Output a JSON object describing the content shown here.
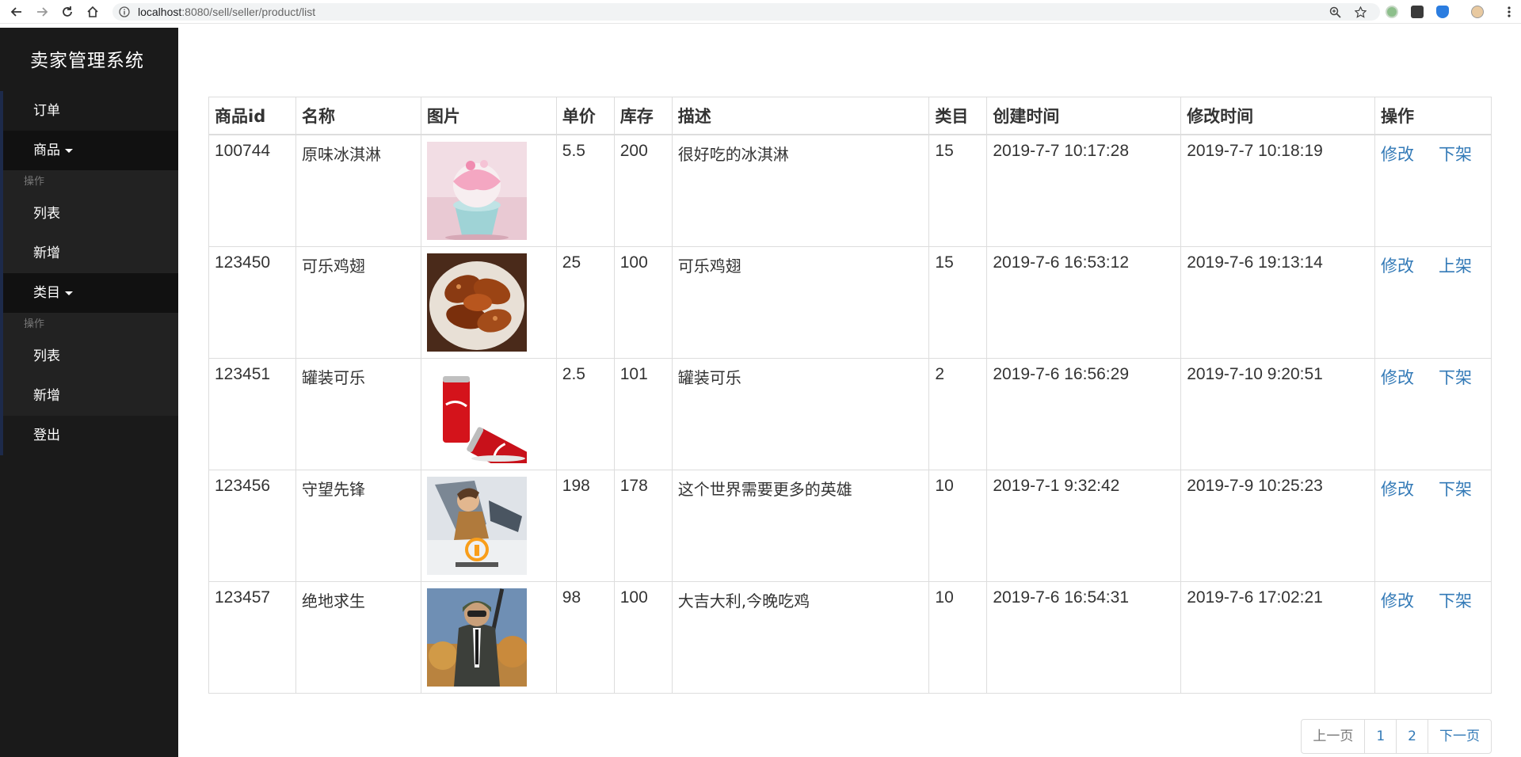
{
  "browser": {
    "url_host": "localhost",
    "url_rest": ":8080/sell/seller/product/list"
  },
  "sidebar": {
    "brand": "卖家管理系统",
    "items": {
      "orders": "订单",
      "products": "商品",
      "products_header": "操作",
      "products_list": "列表",
      "products_new": "新增",
      "categories": "类目",
      "categories_header": "操作",
      "categories_list": "列表",
      "categories_new": "新增",
      "logout": "登出"
    }
  },
  "table": {
    "headers": [
      "商品id",
      "名称",
      "图片",
      "单价",
      "库存",
      "描述",
      "类目",
      "创建时间",
      "修改时间",
      "操作"
    ],
    "rows": [
      {
        "id": "100744",
        "name": "原味冰淇淋",
        "image": "ice-cream-photo",
        "price": "5.5",
        "stock": "200",
        "desc": "很好吃的冰淇淋",
        "category": "15",
        "created": "2019-7-7 10:17:28",
        "updated": "2019-7-7 10:18:19",
        "edit": "修改",
        "toggle": "下架"
      },
      {
        "id": "123450",
        "name": "可乐鸡翅",
        "image": "chicken-wings-photo",
        "price": "25",
        "stock": "100",
        "desc": "可乐鸡翅",
        "category": "15",
        "created": "2019-7-6 16:53:12",
        "updated": "2019-7-6 19:13:14",
        "edit": "修改",
        "toggle": "上架"
      },
      {
        "id": "123451",
        "name": "罐装可乐",
        "image": "cola-cans-photo",
        "price": "2.5",
        "stock": "101",
        "desc": "罐装可乐",
        "category": "2",
        "created": "2019-7-6 16:56:29",
        "updated": "2019-7-10 9:20:51",
        "edit": "修改",
        "toggle": "下架"
      },
      {
        "id": "123456",
        "name": "守望先锋",
        "image": "overwatch-cover",
        "price": "198",
        "stock": "178",
        "desc": "这个世界需要更多的英雄",
        "category": "10",
        "created": "2019-7-1 9:32:42",
        "updated": "2019-7-9 10:25:23",
        "edit": "修改",
        "toggle": "下架"
      },
      {
        "id": "123457",
        "name": "绝地求生",
        "image": "pubg-cover",
        "price": "98",
        "stock": "100",
        "desc": "大吉大利,今晚吃鸡",
        "category": "10",
        "created": "2019-7-6 16:54:31",
        "updated": "2019-7-6 17:02:21",
        "edit": "修改",
        "toggle": "下架"
      }
    ]
  },
  "pagination": {
    "prev": "上一页",
    "pages": [
      "1",
      "2"
    ],
    "next": "下一页"
  },
  "colors": {
    "sidebar_bg": "#1a1a1a",
    "link": "#337ab7",
    "border": "#dddddd"
  }
}
